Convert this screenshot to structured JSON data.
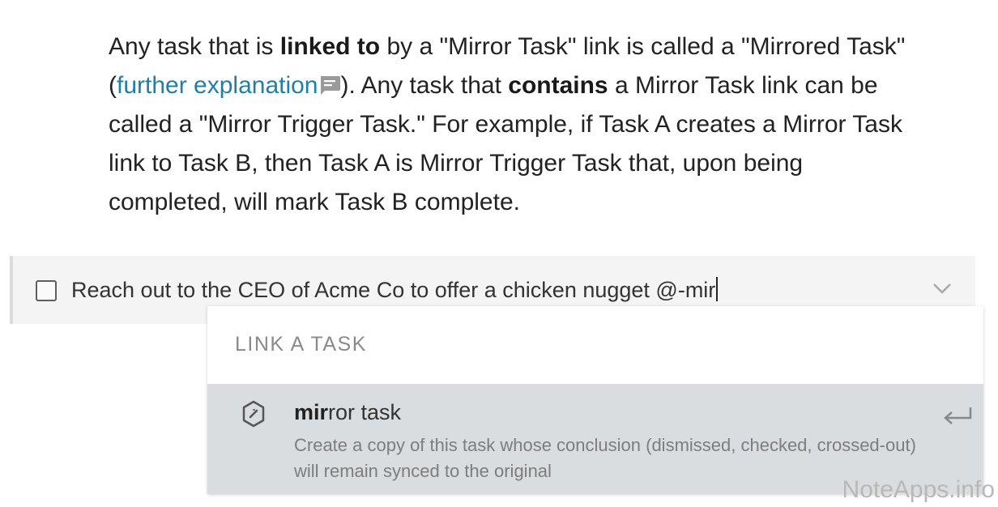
{
  "paragraph": {
    "s1": "Any task that is ",
    "s1_bold": "linked to",
    "s2": " by a \"Mirror Task\" link is called a \"Mirrored Task\" (",
    "link_text": "further explanation",
    "s3": "). Any task that ",
    "s3_bold": "contains",
    "s4": " a Mirror Task link can be called a \"Mirror Trigger Task.\" For example, if Task A creates a Mirror Task link to Task B, then Task A is Mirror Trigger Task that, upon being completed, will mark Task B complete."
  },
  "task": {
    "text": "Reach out to the CEO of Acme Co to offer a chicken nugget @-mir",
    "checked": false
  },
  "dropdown": {
    "header": "LINK A TASK",
    "option": {
      "title_match": "mir",
      "title_rest": "ror task",
      "description": "Create a copy of this task whose conclusion (dismissed, checked, crossed-out) will remain synced to the original",
      "icon": "mirror-task-icon",
      "enter_icon": "enter-icon"
    }
  },
  "watermark": "NoteApps.info",
  "colors": {
    "link": "#1f7fa6",
    "option_highlight": "#d9dde0",
    "text": "#222222"
  }
}
